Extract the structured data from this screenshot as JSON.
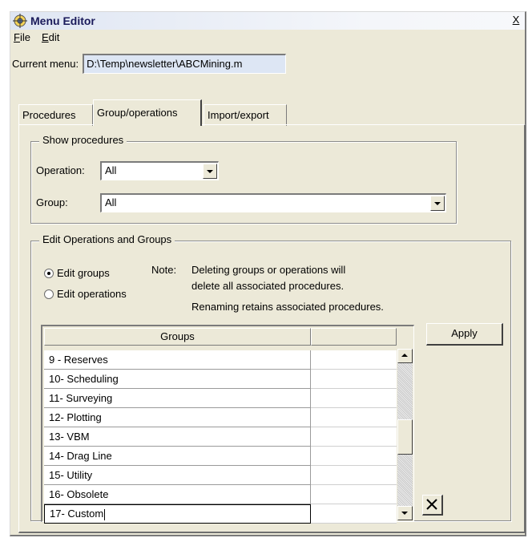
{
  "window": {
    "title": "Menu Editor",
    "close_label": "X"
  },
  "menubar": {
    "file": {
      "underline": "F",
      "rest": "ile"
    },
    "edit": {
      "underline": "E",
      "rest": "dit"
    }
  },
  "current_menu": {
    "label": "Current menu:",
    "value": "D:\\Temp\\newsletter\\ABCMining.m"
  },
  "tabs": [
    {
      "label": "Procedures"
    },
    {
      "label": "Group/operations"
    },
    {
      "label": "Import/export"
    }
  ],
  "show_procedures": {
    "legend": "Show procedures",
    "operation_label": "Operation:",
    "operation_value": "All",
    "group_label": "Group:",
    "group_value": "All"
  },
  "edit_section": {
    "legend": "Edit Operations and Groups",
    "radio_groups": "Edit groups",
    "radio_operations": "Edit operations",
    "note_label": "Note:",
    "note_line1": "Deleting groups or operations will",
    "note_line2": "delete all associated procedures.",
    "note_line3": "Renaming retains associated procedures.",
    "selected": "Edit groups"
  },
  "table": {
    "header_col1": "Groups",
    "header_col2": "",
    "rows": [
      "9 - Reserves",
      "10- Scheduling",
      "11- Surveying",
      "12- Plotting",
      "13- VBM",
      "14- Drag Line",
      "15- Utility",
      "16- Obsolete"
    ],
    "editing_row": "17- Custom"
  },
  "buttons": {
    "apply": "Apply"
  },
  "icons": {
    "app": "menu-editor-icon",
    "close": "close-icon",
    "delete": "delete-x-icon",
    "combo": "chevron-down-icon",
    "scroll_up": "scroll-up-icon",
    "scroll_down": "scroll-down-icon"
  }
}
